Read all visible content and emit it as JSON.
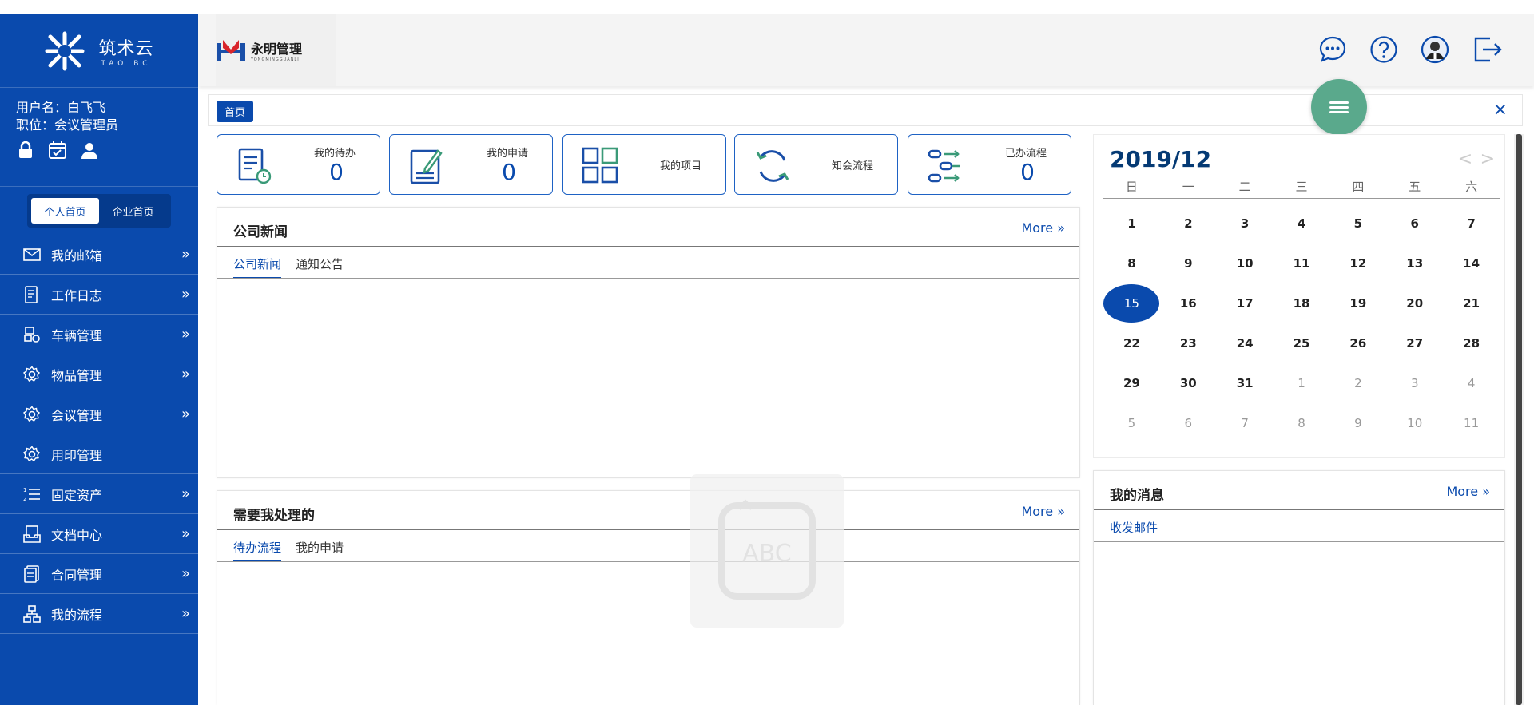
{
  "sidebar": {
    "logo": {
      "title": "筑术云",
      "subtitle": "TAO BC"
    },
    "user": {
      "name_line": "用户名：白飞飞",
      "role_line": "职位：会议管理员"
    },
    "home_switch": {
      "personal": "个人首页",
      "enterprise": "企业首页"
    },
    "menu": [
      {
        "label": "我的邮箱",
        "icon": "mail-icon",
        "arrow": "»"
      },
      {
        "label": "工作日志",
        "icon": "log-icon",
        "arrow": "»"
      },
      {
        "label": "车辆管理",
        "icon": "vehicle-icon",
        "arrow": "»"
      },
      {
        "label": "物品管理",
        "icon": "gear-icon",
        "arrow": "»"
      },
      {
        "label": "会议管理",
        "icon": "gear-icon",
        "arrow": "»"
      },
      {
        "label": "用印管理",
        "icon": "gear-icon",
        "arrow": ""
      },
      {
        "label": "固定资产",
        "icon": "list-icon",
        "arrow": "»"
      },
      {
        "label": "文档中心",
        "icon": "document-icon",
        "arrow": "»"
      },
      {
        "label": "合同管理",
        "icon": "contract-icon",
        "arrow": "»"
      },
      {
        "label": "我的流程",
        "icon": "flow-icon",
        "arrow": "»"
      }
    ]
  },
  "topbar": {
    "brand": {
      "name": "永明管理",
      "subtitle": "YONGMINGGUANLI"
    }
  },
  "tabbar": {
    "home_tab": "首页",
    "close": "×"
  },
  "stats": [
    {
      "label": "我的待办",
      "value": "0"
    },
    {
      "label": "我的申请",
      "value": "0"
    },
    {
      "label": "我的项目",
      "value": ""
    },
    {
      "label": "知会流程",
      "value": ""
    },
    {
      "label": "已办流程",
      "value": "0"
    }
  ],
  "news_panel": {
    "title": "公司新闻",
    "more": "More",
    "tabs": [
      "公司新闻",
      "通知公告"
    ]
  },
  "todo_panel": {
    "title": "需要我处理的",
    "more": "More",
    "tabs": [
      "待办流程",
      "我的申请"
    ]
  },
  "messages_panel": {
    "title": "我的消息",
    "more": "More",
    "tabs": [
      "收发邮件"
    ]
  },
  "calendar": {
    "title": "2019/12",
    "prev": "<",
    "next": ">",
    "weekdays": [
      "日",
      "一",
      "二",
      "三",
      "四",
      "五",
      "六"
    ],
    "weeks": [
      [
        "1",
        "2",
        "3",
        "4",
        "5",
        "6",
        "7"
      ],
      [
        "8",
        "9",
        "10",
        "11",
        "12",
        "13",
        "14"
      ],
      [
        "15",
        "16",
        "17",
        "18",
        "19",
        "20",
        "21"
      ],
      [
        "22",
        "23",
        "24",
        "25",
        "26",
        "27",
        "28"
      ],
      [
        "29",
        "30",
        "31",
        "1",
        "2",
        "3",
        "4"
      ],
      [
        "5",
        "6",
        "7",
        "8",
        "9",
        "10",
        "11"
      ]
    ],
    "today": "15"
  },
  "watermark_text": "ABC",
  "colors": {
    "primary": "#0a4aad",
    "fab": "#5aa98c"
  }
}
